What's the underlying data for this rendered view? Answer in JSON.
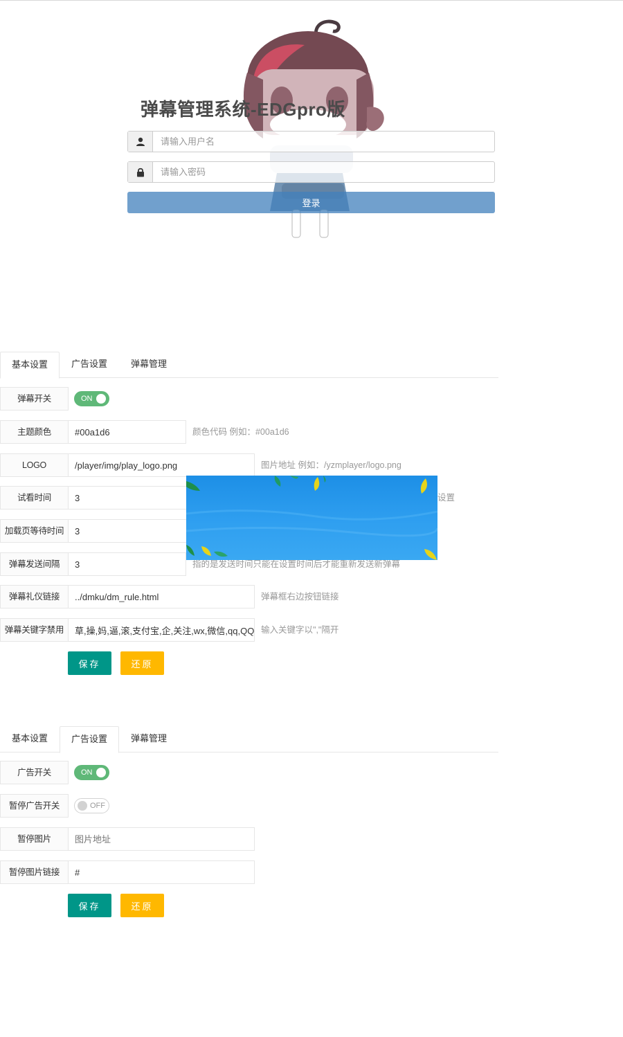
{
  "login": {
    "title": "弹幕管理系统-EDGpro版",
    "username_placeholder": "请输入用户名",
    "password_placeholder": "请输入密码",
    "submit_label": "登录",
    "user_icon": "user-icon",
    "lock_icon": "lock-icon"
  },
  "panel1": {
    "tabs": [
      {
        "label": "基本设置",
        "active": true
      },
      {
        "label": "广告设置",
        "active": false
      },
      {
        "label": "弹幕管理",
        "active": false
      }
    ],
    "rows": [
      {
        "label": "弹幕开关",
        "switch": "ON"
      },
      {
        "label": "主题颜色",
        "value": "#00a1d6",
        "hint": "颜色代码 例如：#00a1d6"
      },
      {
        "label": "LOGO",
        "value": "/player/img/play_logo.png",
        "hint": "图片地址 例如：/yzmplayer/logo.png"
      },
      {
        "label": "试看时间",
        "value": "3",
        "hint": "设置"
      },
      {
        "label": "加载页等待时间",
        "value": "3",
        "hint": ""
      },
      {
        "label": "弹幕发送间隔",
        "value": "3",
        "hint": "指的是发送时间只能在设置时间后才能重新发送新弹幕"
      },
      {
        "label": "弹幕礼仪链接",
        "value": "../dmku/dm_rule.html",
        "hint": "弹幕框右边按钮链接"
      },
      {
        "label": "弹幕关键字禁用",
        "value": "草,操,妈,逼,滚,支付宝,企,关注,wx,微信,qq,QQ",
        "hint": "输入关键字以\",\"隔开"
      }
    ],
    "save_label": "保存",
    "reset_label": "还原"
  },
  "panel2": {
    "tabs": [
      {
        "label": "基本设置",
        "active": false
      },
      {
        "label": "广告设置",
        "active": true
      },
      {
        "label": "弹幕管理",
        "active": false
      }
    ],
    "rows": [
      {
        "label": "广告开关",
        "switch": "ON"
      },
      {
        "label": "暂停广告开关",
        "switch": "OFF"
      },
      {
        "label": "暂停图片",
        "value": "",
        "placeholder": "图片地址"
      },
      {
        "label": "暂停图片链接",
        "value": "#"
      }
    ],
    "save_label": "保存",
    "reset_label": "还原"
  },
  "colors": {
    "switch_on": "#5fb878",
    "save_button": "#009688",
    "reset_button": "#ffb800",
    "login_button": "#6b9ed0",
    "ad_sky": "#2b9ae9"
  }
}
